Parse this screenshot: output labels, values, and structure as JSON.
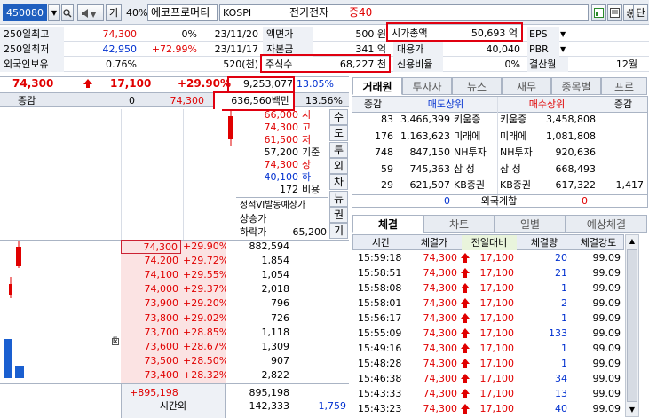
{
  "toolbar": {
    "code": "450080",
    "type_label": "거",
    "percent_label": "40%",
    "stock_name": "에코프로머티",
    "market": "KOSPI",
    "sector": "전기전자",
    "margin": "증40",
    "unit_button": "단"
  },
  "info": {
    "row1": {
      "l1": "250일최고",
      "v1": "74,300",
      "p1": "0%",
      "d1": "23/11/20",
      "l2": "액면가",
      "v2": "500 원",
      "l3": "시가총액",
      "v3": "50,693 억",
      "l4": "EPS",
      "v4": ""
    },
    "row2": {
      "l1": "250일최저",
      "v1": "42,950",
      "p1": "+72.99%",
      "d1": "23/11/17",
      "l2": "자본금",
      "v2": "341 억",
      "l3": "대용가",
      "v3": "40,040",
      "l4": "PBR",
      "v4": ""
    },
    "row3": {
      "l1": "외국인보유",
      "v1": "0.76%",
      "p1": "520(천)",
      "l2": "주식수",
      "v2": "68,227 천",
      "l3": "신용비율",
      "v3": "0%",
      "l4": "결산월",
      "v4": "12월"
    }
  },
  "quote": {
    "price": "74,300",
    "change": "17,100",
    "change_pct": "+29.90%",
    "volume": "9,253,077",
    "ratio": "13.05%",
    "amount": "636,560백만",
    "diff_label": "증감",
    "diff_val": "0",
    "diff_price": "74,300",
    "diff_pct": "13.56%"
  },
  "price_levels": [
    {
      "price": "66,000",
      "label": "시"
    },
    {
      "price": "74,300",
      "label": "고"
    },
    {
      "price": "61,500",
      "label": "저"
    },
    {
      "price": "57,200",
      "label": "기준"
    },
    {
      "price": "74,300",
      "label": "상"
    },
    {
      "price": "40,100",
      "label": "하"
    },
    {
      "price": "172",
      "label": "비용"
    }
  ],
  "vi": {
    "title": "정적VI발동예상가",
    "up": "상승가",
    "down": "하락가",
    "down_val": "65,200"
  },
  "vtabs": [
    "수",
    "도",
    "투",
    "외",
    "차",
    "뉴",
    "권",
    "기"
  ],
  "bids": [
    {
      "price": "74,300",
      "pct": "+29.90%",
      "qty": "882,594"
    },
    {
      "price": "74,200",
      "pct": "+29.72%",
      "qty": "1,854"
    },
    {
      "price": "74,100",
      "pct": "+29.55%",
      "qty": "1,054"
    },
    {
      "price": "74,000",
      "pct": "+29.37%",
      "qty": "2,018"
    },
    {
      "price": "73,900",
      "pct": "+29.20%",
      "qty": "796"
    },
    {
      "price": "73,800",
      "pct": "+29.02%",
      "qty": "726"
    },
    {
      "price": "73,700",
      "pct": "+28.85%",
      "qty": "1,118"
    },
    {
      "price": "73,600",
      "pct": "+28.67%",
      "qty": "1,309"
    },
    {
      "price": "73,500",
      "pct": "+28.50%",
      "qty": "907"
    },
    {
      "price": "73,400",
      "pct": "+28.32%",
      "qty": "2,822"
    }
  ],
  "totals": {
    "left": "+895,198",
    "mid": "895,198",
    "after_label": "시간외",
    "after_val": "142,333",
    "after_right": "1,759"
  },
  "broker": {
    "tabs": [
      "거래원",
      "투자자",
      "뉴스",
      "재무",
      "종목별",
      "프로"
    ],
    "h_diff": "증감",
    "h_sell": "매도상위",
    "h_buy": "매수상위",
    "h_diff2": "증감",
    "rows": [
      {
        "d1": "83",
        "sq": "3,466,399",
        "sn": "키움증",
        "bn": "키움증",
        "bq": "3,458,808",
        "d2": ""
      },
      {
        "d1": "176",
        "sq": "1,163,623",
        "sn": "미래에",
        "bn": "미래에",
        "bq": "1,081,808",
        "d2": ""
      },
      {
        "d1": "748",
        "sq": "847,150",
        "sn": "NH투자",
        "bn": "NH투자",
        "bq": "920,636",
        "d2": ""
      },
      {
        "d1": "59",
        "sq": "745,363",
        "sn": "삼 성",
        "bn": "삼 성",
        "bq": "668,493",
        "d2": ""
      },
      {
        "d1": "29",
        "sq": "621,507",
        "sn": "KB증권",
        "bn": "KB증권",
        "bq": "617,322",
        "d2": "1,417"
      }
    ],
    "foreign_left": "0",
    "foreign_label": "외국계합",
    "foreign_right": "0"
  },
  "trades": {
    "tabs": [
      "체결",
      "차트",
      "일별",
      "예상체결"
    ],
    "headers": [
      "시간",
      "체결가",
      "전일대비",
      "체결량",
      "체결강도"
    ],
    "rows": [
      {
        "t": "15:59:18",
        "p": "74,300",
        "c": "17,100",
        "q": "20",
        "s": "99.09"
      },
      {
        "t": "15:58:51",
        "p": "74,300",
        "c": "17,100",
        "q": "21",
        "s": "99.09"
      },
      {
        "t": "15:58:08",
        "p": "74,300",
        "c": "17,100",
        "q": "1",
        "s": "99.09"
      },
      {
        "t": "15:58:01",
        "p": "74,300",
        "c": "17,100",
        "q": "2",
        "s": "99.09"
      },
      {
        "t": "15:56:17",
        "p": "74,300",
        "c": "17,100",
        "q": "1",
        "s": "99.09"
      },
      {
        "t": "15:55:09",
        "p": "74,300",
        "c": "17,100",
        "q": "133",
        "s": "99.09"
      },
      {
        "t": "15:49:16",
        "p": "74,300",
        "c": "17,100",
        "q": "1",
        "s": "99.09"
      },
      {
        "t": "15:48:28",
        "p": "74,300",
        "c": "17,100",
        "q": "1",
        "s": "99.09"
      },
      {
        "t": "15:46:38",
        "p": "74,300",
        "c": "17,100",
        "q": "34",
        "s": "99.09"
      },
      {
        "t": "15:43:33",
        "p": "74,300",
        "c": "17,100",
        "q": "13",
        "s": "99.09"
      },
      {
        "t": "15:43:23",
        "p": "74,300",
        "c": "17,100",
        "q": "40",
        "s": "99.09"
      }
    ]
  },
  "colors": {
    "up": "#e00000",
    "down": "#0030d0",
    "highlight": "#e00010",
    "bid_bg": "#fbe3e3"
  }
}
